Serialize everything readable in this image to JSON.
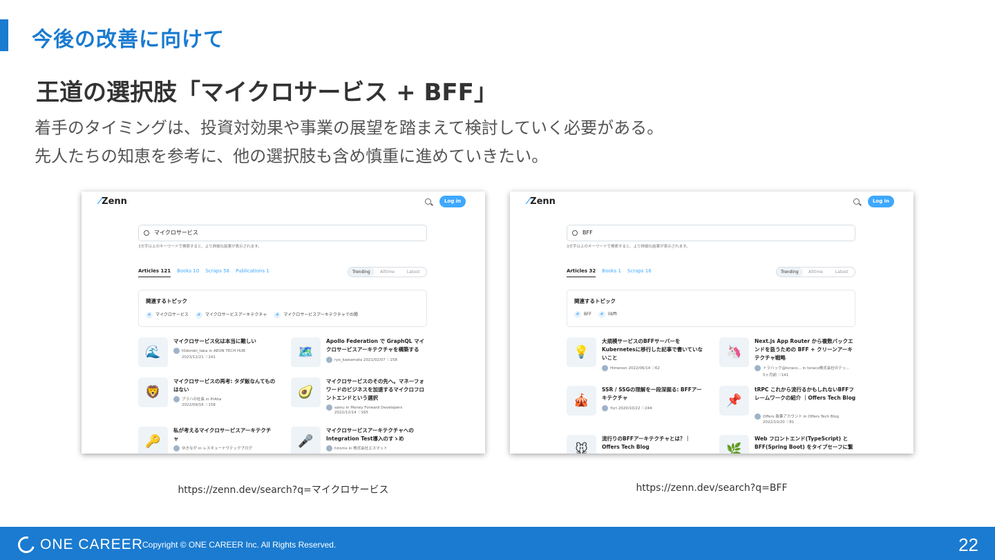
{
  "section_title": "今後の改善に向けて",
  "main_title": "王道の選択肢「マイクロサービス + BFF」",
  "body": [
    "着手のタイミングは、投資対効果や事業の展望を踏まえて検討していく必要がある。",
    "先人たちの知恵を参考に、他の選択肢も含め慎重に進めていきたい。"
  ],
  "screens": [
    {
      "logo": "Zenn",
      "login": "Log in",
      "query": "マイクロサービス",
      "hint": "3文字以上のキーワードで検索すると、より詳細な結果が表示されます。",
      "tabs": [
        "Articles 121",
        "Books 10",
        "Scraps 58",
        "Publications 1"
      ],
      "sort": [
        "Trending",
        "Alltime",
        "Latest"
      ],
      "topics_title": "関連するトピック",
      "topics": [
        "マイクロサービス",
        "マイクロサービスアーキテクチャ",
        "マイクロサービスアーキテクチャでの開"
      ],
      "cards": [
        {
          "emoji": "🌊",
          "title": "マイクロサービス化は本当に難しい",
          "meta1": "t0doroki_taka in AEON TECH HUB",
          "meta2": "2023/12/21 ♡241"
        },
        {
          "emoji": "🗺️",
          "title": "Apollo Federation で GraphQL マイクロサービスアーキテクチャを構築する",
          "meta1": "ryo_kawamata 2021/02/07 ♡158",
          "meta2": ""
        },
        {
          "emoji": "🦁",
          "title": "マイクロサービスの再考: タダ飯なんてものはない",
          "meta1": "ブラハの社長 in PrAha",
          "meta2": "2022/09/16 ♡158"
        },
        {
          "emoji": "🥑",
          "title": "マイクロサービスのその先へ。マネーフォワードのビジネスを加速するマイクロフロントエンドという選択",
          "meta1": "sainu in Money Forward Developers",
          "meta2": "2022/12/14 ♡165"
        },
        {
          "emoji": "🔑",
          "title": "私が考えるマイクロサービスアーキテクチャ",
          "meta1": "ゆきなが in レスキューナウテックブログ",
          "meta2": ""
        },
        {
          "emoji": "🎤",
          "title": "マイクロサービスアーキテクチャへの Integration Test導入のすゝめ",
          "meta1": "hiroms in 株式会社エスマット",
          "meta2": ""
        }
      ],
      "caption": "https://zenn.dev/search?q=マイクロサービス"
    },
    {
      "logo": "Zenn",
      "login": "Log in",
      "query": "BFF",
      "hint": "3文字以上のキーワードで検索すると、より詳細な結果が表示されます。",
      "tabs": [
        "Articles 32",
        "Books 1",
        "Scraps 16"
      ],
      "sort": [
        "Trending",
        "Alltime",
        "Latest"
      ],
      "topics_title": "関連するトピック",
      "topics": [
        "BFF",
        "libffi"
      ],
      "cards": [
        {
          "emoji": "💡",
          "title": "大規模サービスのBFFサーバーをKubernetesに移行した記事で書いていないこと",
          "meta1": "Himenon 2022/06/14 ♡62",
          "meta2": ""
        },
        {
          "emoji": "🦄",
          "title": "Next.js App Router から複数バックエンドを扱うための BFF + クリーンアーキテクチャ戦略",
          "meta1": "トラハック@toraco... in toraco株式会社のテッ...",
          "meta2": "5ヶ月前 ♡141"
        },
        {
          "emoji": "🎪",
          "title": "SSR / SSGの理解を一段深掘る: BFFアーキテクチャ",
          "meta1": "Yuri 2020/10/22 ♡244",
          "meta2": ""
        },
        {
          "emoji": "📌",
          "title": "tRPC これから流行るかもしれないBFFフレームワークの紹介 ｜Offers Tech Blog",
          "meta1": "Offers 執筆アカウント in Offers Tech Blog",
          "meta2": "2022/10/20 ♡81"
        },
        {
          "emoji": "🐭",
          "title": "流行りのBFFアーキテクチャとは？｜Offers Tech Blog",
          "meta1": "",
          "meta2": ""
        },
        {
          "emoji": "🌿",
          "title": "Web フロントエンド(TypeScript) と BFF(Spring Boot) をタイプセーフに繋",
          "meta1": "",
          "meta2": ""
        }
      ],
      "caption": "https://zenn.dev/search?q=BFF"
    }
  ],
  "footer": {
    "logo_text": "ONE CAREER",
    "copyright": "Copyright © ONE CAREER Inc. All Rights Reserved.",
    "page_number": "22"
  },
  "colors": {
    "accent": "#1a7bd0",
    "zenn_blue": "#3ea8ff"
  }
}
